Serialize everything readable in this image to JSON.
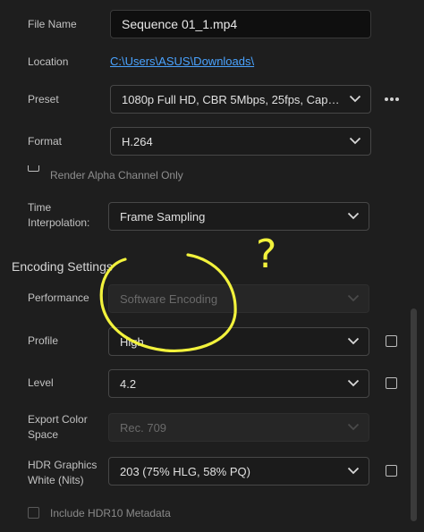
{
  "file_name": {
    "label": "File Name",
    "value": "Sequence 01_1.mp4"
  },
  "location": {
    "label": "Location",
    "value": "C:\\Users\\ASUS\\Downloads\\"
  },
  "preset": {
    "label": "Preset",
    "value": "1080p Full HD, CBR 5Mbps, 25fps, Caption b...",
    "more_icon": "more-horizontal-icon"
  },
  "format": {
    "label": "Format",
    "value": "H.264"
  },
  "render_alpha": {
    "label": "Render Alpha Channel Only"
  },
  "time_interpolation": {
    "label_line1": "Time",
    "label_line2": "Interpolation:",
    "value": "Frame Sampling"
  },
  "encoding_section": {
    "title": "Encoding Settings"
  },
  "performance": {
    "label": "Performance",
    "value": "Software Encoding"
  },
  "profile": {
    "label": "Profile",
    "value": "High"
  },
  "level": {
    "label": "Level",
    "value": "4.2"
  },
  "export_color_space": {
    "label_line1": "Export Color",
    "label_line2": "Space",
    "value": "Rec. 709"
  },
  "hdr_graphics": {
    "label_line1": "HDR Graphics",
    "label_line2": "White (Nits)",
    "value": "203 (75% HLG, 58% PQ)"
  },
  "hdr10": {
    "label": "Include HDR10 Metadata"
  },
  "annotation": {
    "mark": "?",
    "color": "#f2f23c"
  },
  "colors": {
    "link": "#4aa3ff",
    "background": "#1e1e1e"
  }
}
